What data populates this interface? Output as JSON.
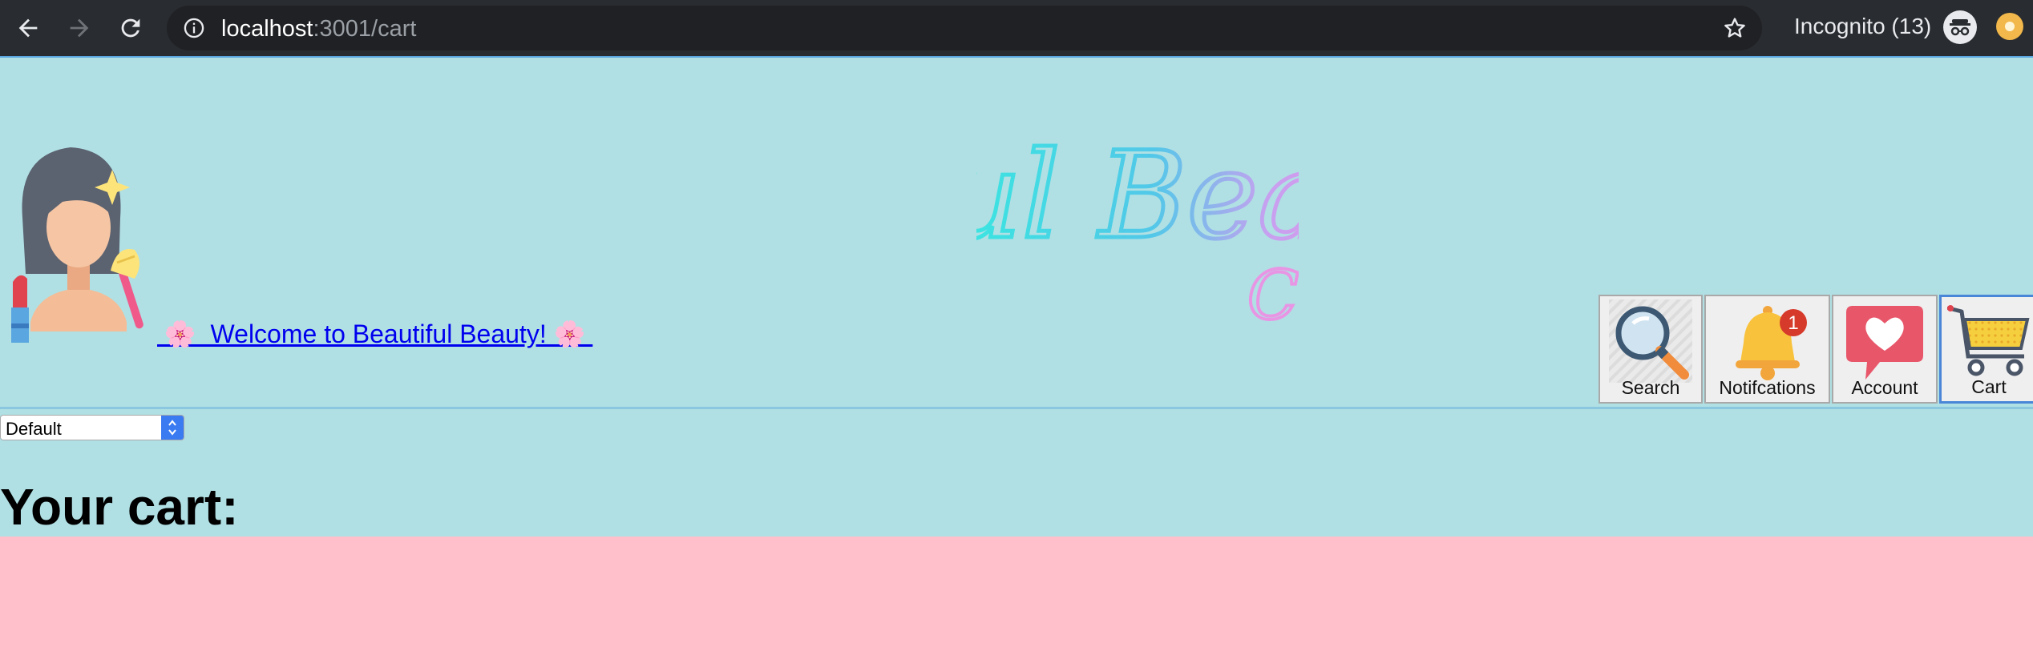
{
  "browser": {
    "url_host": "localhost",
    "url_path": ":3001/cart",
    "incognito_label": "Incognito (13)"
  },
  "header": {
    "welcome_text": " 🌸  Welcome to Beautiful Beauty! 🌸 ",
    "logo_text": "ul Beau",
    "logo_fragment": "C"
  },
  "nav": {
    "items": [
      {
        "label": "Search",
        "icon": "magnifier-icon"
      },
      {
        "label": "Notifcations",
        "icon": "bell-icon",
        "badge": "1"
      },
      {
        "label": "Account",
        "icon": "heart-chat-icon"
      },
      {
        "label": "Cart",
        "icon": "shopping-cart-icon",
        "active": true
      }
    ]
  },
  "sort": {
    "selected": "Default"
  },
  "cart": {
    "heading": "Your cart:"
  },
  "colors": {
    "page_background": "#b0e0e4",
    "cart_panel": "#ffc0cb",
    "link": "#0000ee",
    "active_outline": "#4a86d8"
  }
}
